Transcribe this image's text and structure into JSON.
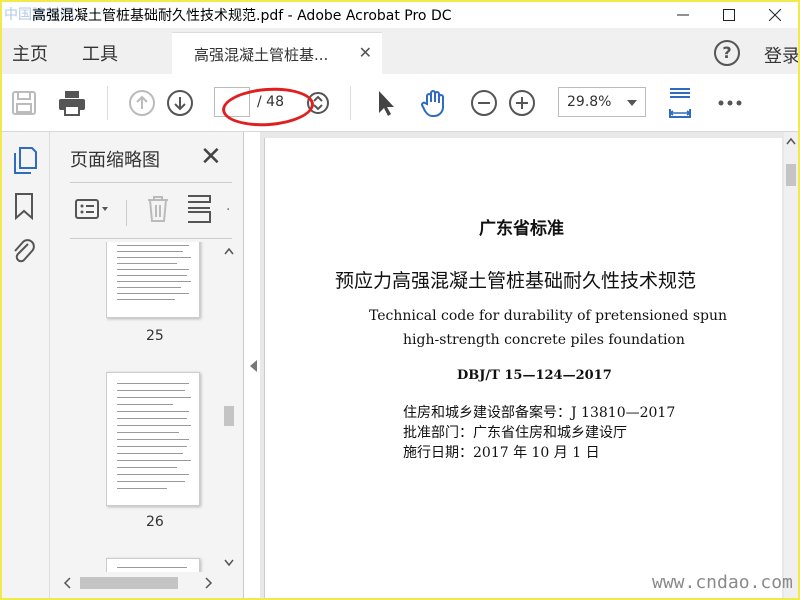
{
  "window": {
    "title": "高强混凝土管桩基础耐久性技术规范.pdf - Adobe Acrobat Pro DC",
    "watermark_top": "中国建材网",
    "watermark_bottom": "www.cndao.com"
  },
  "menubar": {
    "home": "主页",
    "tools": "工具",
    "doc_tab": "高强混凝土管桩基...",
    "login": "登录"
  },
  "toolbar": {
    "page_current": "",
    "page_total": "/ 48",
    "zoom": "29.8%"
  },
  "panel": {
    "title": "页面缩略图",
    "thumb_labels": [
      "25",
      "26"
    ]
  },
  "document": {
    "line1": "广东省标准",
    "line2": "预应力高强混凝土管桩基础耐久性技术规范",
    "line3": "Technical code for durability of pretensioned spun",
    "line4": "high-strength concrete piles foundation",
    "line5": "DBJ/T 15—124—2017",
    "line6": "住房和城乡建设部备案号：J 13810—2017",
    "line7": "批准部门：广东省住房和城乡建设厅",
    "line8": "施行日期：2017 年 10 月 1 日"
  },
  "colors": {
    "accent": "#2d6cc0",
    "annotation": "#e02020",
    "frame": "#f2e94e"
  }
}
